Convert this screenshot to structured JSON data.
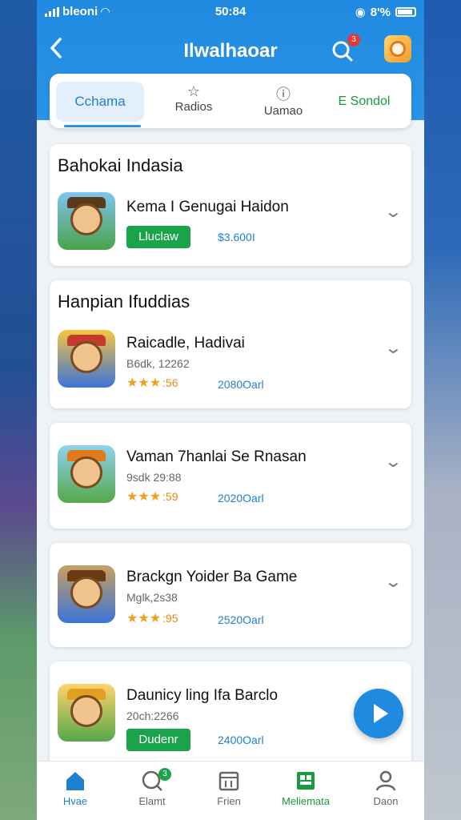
{
  "status_bar": {
    "carrier": "bleoni",
    "time": "50:84",
    "battery": "8'%"
  },
  "header": {
    "title": "Ilwalhaoar",
    "notification_count": "3"
  },
  "tabs": [
    {
      "label": "Cchama",
      "active": true
    },
    {
      "label": "Radios",
      "icon": "star-icon"
    },
    {
      "label": "Uamao",
      "icon": "info-icon"
    },
    {
      "label": "E Sondol",
      "color": "#1a9a3f"
    }
  ],
  "sections": [
    {
      "title": "Bahokai Indasia",
      "items": [
        {
          "name": "Kema I Genugai Haidon",
          "button": "Lluclaw",
          "number": "$3.600I"
        }
      ]
    },
    {
      "title": "Hanpian Ifuddias",
      "items": [
        {
          "name": "Raicadle, Hadivai",
          "meta": "B6dk, 12262",
          "rating": "★★★",
          "rating_value": ":56",
          "number": "2080Oarl"
        }
      ]
    }
  ],
  "cards": [
    {
      "name": "Vaman 7hanlai Se Rnasan",
      "meta": "9sdk 29:88",
      "rating": "★★★",
      "rating_value": ":59",
      "number": "2020Oarl"
    },
    {
      "name": "Brackgn Yoider Ba Game",
      "meta": "Mglk,2s38",
      "rating": "★★★",
      "rating_value": ":95",
      "number": "2520Oarl"
    },
    {
      "name": "Daunicy ling Ifa Barclo",
      "meta": "20ch:2266",
      "button": "Dudenr",
      "number": "2400Oarl"
    }
  ],
  "bottom_nav": [
    {
      "label": "Hvae",
      "icon": "home-icon",
      "active": true
    },
    {
      "label": "Elamt",
      "icon": "chat-icon",
      "badge": "3"
    },
    {
      "label": "Frien",
      "icon": "calendar-icon"
    },
    {
      "label": "Meliemata",
      "icon": "board-icon",
      "color": "#1a9a3f"
    },
    {
      "label": "Daon",
      "icon": "user-icon"
    }
  ],
  "colors": {
    "primary": "#1f8ae0",
    "green": "#1aa34a",
    "star": "#f0a020"
  }
}
